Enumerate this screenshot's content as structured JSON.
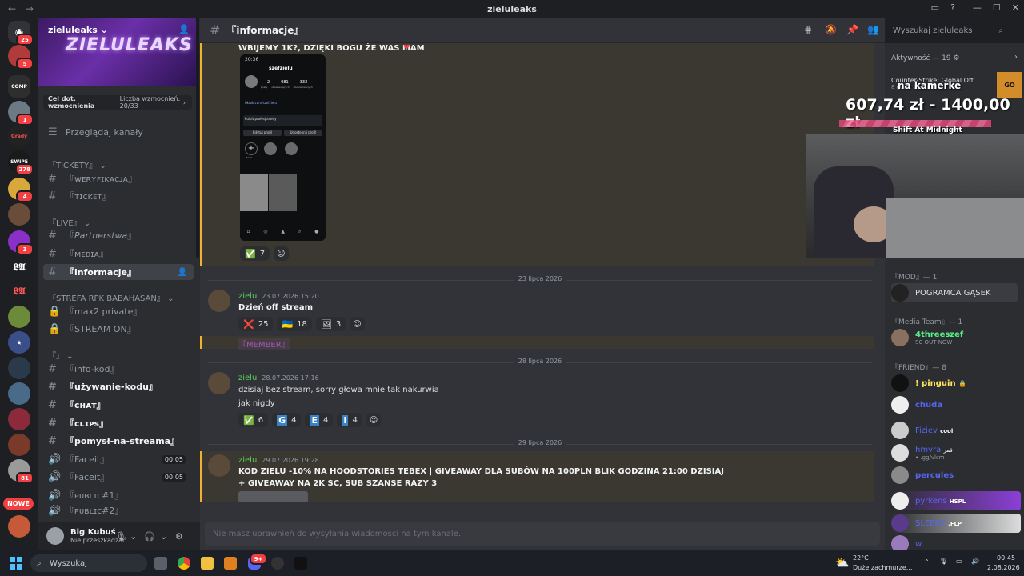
{
  "window": {
    "title": "zieluleaks",
    "back": "←",
    "forward": "→"
  },
  "servers": {
    "badges": [
      "25",
      "5",
      "",
      "1",
      "",
      "278",
      "4",
      "",
      "3",
      "",
      "",
      "",
      "",
      "",
      "",
      "",
      "",
      "81",
      ""
    ],
    "new_label": "NOWE"
  },
  "server": {
    "name": "zieluleaks",
    "banner_text": "ZIELULEAKS",
    "boost_goal": "Cel dot. wzmocnienia",
    "boost_count": "Liczba wzmocnień: 20/33",
    "browse": "Przeglądaj kanały"
  },
  "categories": [
    {
      "name": "『TICKETY』",
      "channels": [
        {
          "name": "『ᴡᴇʀʏꜰɪᴋᴀᴄᴊᴀ』"
        },
        {
          "name": "『ᴛɪᴄᴋᴇᴛ』"
        }
      ]
    },
    {
      "name": "『LIVE』",
      "channels": [
        {
          "name": "『𝘗𝘢𝘳𝘵𝘯𝘦𝘳𝘴𝘵𝘸𝘢』"
        },
        {
          "name": "『ᴍᴇᴅɪᴀ』"
        },
        {
          "name": "『informacje』"
        }
      ]
    },
    {
      "name": "『STREFA RPK BABAHASAN』",
      "channels": [
        {
          "name": "『max2 private』"
        },
        {
          "name": "『STREAM ON』"
        }
      ]
    },
    {
      "name": "『』",
      "channels": [
        {
          "name": "『info-kod』"
        },
        {
          "name": "『używanie-kodu』"
        },
        {
          "name": "『ᴄʜᴀᴛ』"
        },
        {
          "name": "『ᴄʟɪᴘꜱ』"
        },
        {
          "name": "『pomysł-na-streama』"
        },
        {
          "name": "『Faceit』",
          "v1": "00",
          "v2": "05"
        },
        {
          "name": "『Faceit』",
          "v1": "00",
          "v2": "05"
        },
        {
          "name": "『ᴘᴜʙʟɪᴄ#1』"
        },
        {
          "name": "『ᴘᴜʙʟɪᴄ#2』"
        }
      ]
    }
  ],
  "user": {
    "name": "Big Kubuś",
    "status": "Nie przeszkadzać"
  },
  "channel": {
    "name": "『informacje』",
    "search_placeholder": "Wyszukaj zieluleaks",
    "composer": "Nie masz uprawnień do wysyłania wiadomości na tym kanale."
  },
  "phone": {
    "time": "20:36",
    "username": "szefzielu",
    "posts": "2",
    "followers": "981",
    "following": "332",
    "posts_label": "posty",
    "followers_label": "obserwujących",
    "following_label": "obserwowanych",
    "link": "tiktok.com/szefzielu",
    "btn_edit": "Edytuj profil",
    "btn_share": "Udostępnij profil",
    "panel": "Pulpit profesjonalny",
    "new_label": "Nowe"
  },
  "messages": [
    {
      "text": "WBIJEMY 1K?, DZIĘKI BOGU ŻE WAS MAM",
      "reactions": [
        {
          "emoji": "✅",
          "count": "7"
        }
      ]
    },
    {
      "date": "23 lipca 2026",
      "author": "zielu",
      "time": "23.07.2026 15:20",
      "text": "Dzień off stream",
      "reactions": [
        {
          "emoji": "❌",
          "count": "25"
        },
        {
          "emoji": "🇺🇦",
          "count": "18"
        },
        {
          "emoji": "🖼",
          "count": "3"
        }
      ]
    },
    {
      "role_text": "『MEMBER』"
    },
    {
      "date": "28 lipca 2026",
      "author": "zielu",
      "time": "28.07.2026 17:16",
      "text": "dzisiaj bez stream, sorry głowa mnie tak nakurwia",
      "text2": "jak nigdy",
      "reactions": [
        {
          "emoji": "✅",
          "count": "6"
        },
        {
          "emoji": "G",
          "count": "4"
        },
        {
          "emoji": "E",
          "count": "4"
        },
        {
          "emoji": "I",
          "count": "4"
        }
      ]
    },
    {
      "date": "29 lipca 2026",
      "author": "zielu",
      "time": "29.07.2026 19:28",
      "text": "KOD ZIELU -10% NA HOODSTORIES TEBEX | GIVEAWAY DLA SUBÓW NA 100PLN BLIK GODZINA 21:00 DZISIAJ",
      "text2": "+ GIVEAWAY NA 2K SC, SUB SZANSE RAZY 3"
    }
  ],
  "members": {
    "activity": "Aktywność — 19 ⚙",
    "roles": [
      {
        "name": "『MOD』— 1",
        "users": [
          {
            "name": "POGRAMCA GĄSEK",
            "color": "#dbdee1"
          }
        ]
      },
      {
        "name": "『Media Team』— 1",
        "users": [
          {
            "name": "4threeszef",
            "color": "#57f287",
            "status": "SC OUT NOW"
          }
        ]
      },
      {
        "name": "『FRIEND』— 8",
        "users": [
          {
            "name": "! pinguin",
            "color": "#fee75c",
            "tag": "🔒"
          },
          {
            "name": "chuda",
            "color": "#5865f2"
          },
          {
            "name": "Fiziev",
            "color": "#5865f2",
            "tag": "cool"
          },
          {
            "name": "hmvra",
            "color": "#5865f2",
            "tag": "قمر",
            "status": "• .gg/vlcm"
          },
          {
            "name": "percules",
            "color": "#5865f2"
          },
          {
            "name": "pyrkens",
            "color": "#5865f2",
            "tag": "HSPL"
          },
          {
            "name": "SLEEKZ",
            "color": "#5865f2",
            "tag": ".FLP"
          },
          {
            "name": "w.",
            "color": "#5865f2"
          }
        ]
      }
    ]
  },
  "stream_overlay": {
    "amount_current": "607,74 zł",
    "amount_goal": "1400,00 zł",
    "title": "na kamerke",
    "song": "Shift At Midnight",
    "game": "Counter-Strike: Global Off...",
    "game_hours": "8 godz. temu"
  },
  "taskbar": {
    "search": "Wyszukaj",
    "weather_temp": "22°C",
    "weather_desc": "Duże zachmurze...",
    "time": "00:45",
    "date": "2.08.2026",
    "discord_badge": "9+"
  },
  "colors": {
    "accent": "#5865f2",
    "highlight": "#f0b232",
    "online": "#23a55a",
    "dnd": "#f23f42"
  }
}
